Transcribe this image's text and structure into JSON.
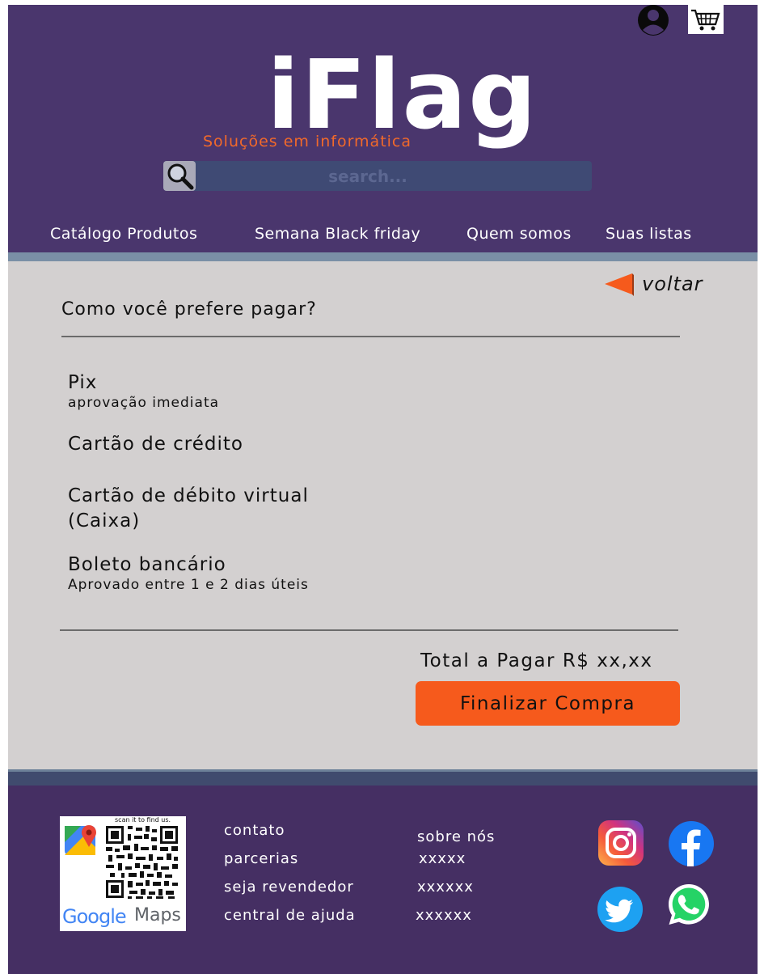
{
  "brand": {
    "logo": "iFlag",
    "tagline": "Soluções em informática"
  },
  "search": {
    "placeholder": "search..."
  },
  "nav": {
    "items": [
      {
        "label": "Catálogo Produtos"
      },
      {
        "label": "Semana Black friday"
      },
      {
        "label": "Quem somos"
      },
      {
        "label": "Suas listas"
      }
    ]
  },
  "icons": {
    "user": "user-circle-icon",
    "cart": "shopping-cart-icon",
    "search": "magnifier-icon",
    "back": "back-arrow-icon"
  },
  "checkout": {
    "back_label": "voltar",
    "title": "Como você prefere pagar?",
    "options": [
      {
        "label": "Pix",
        "sub": "aprovação imediata"
      },
      {
        "label": "Cartão de crédito",
        "sub": ""
      },
      {
        "label": "Cartão de débito virtual",
        "label2": "(Caixa)",
        "sub": ""
      },
      {
        "label": "Boleto bancário",
        "sub": "Aprovado entre 1 e 2 dias úteis"
      }
    ],
    "total_label": "Total a Pagar  R$ xx,xx",
    "finish_label": "Finalizar Compra"
  },
  "footer": {
    "qr": {
      "caption": "scan it to find us.",
      "google": "Google",
      "maps": "Maps"
    },
    "col1": [
      "contato",
      "parcerias",
      "seja revendedor",
      "central de ajuda"
    ],
    "col2": [
      "sobre nós",
      "xxxxx",
      "xxxxxx",
      "xxxxxx"
    ],
    "social": [
      "instagram-icon",
      "facebook-icon",
      "twitter-icon",
      "whatsapp-icon"
    ]
  },
  "colors": {
    "header_bg": "#4a366d",
    "accent_orange": "#f65a1c",
    "content_bg": "#d3d0d0",
    "footer_bg": "#452f63"
  }
}
